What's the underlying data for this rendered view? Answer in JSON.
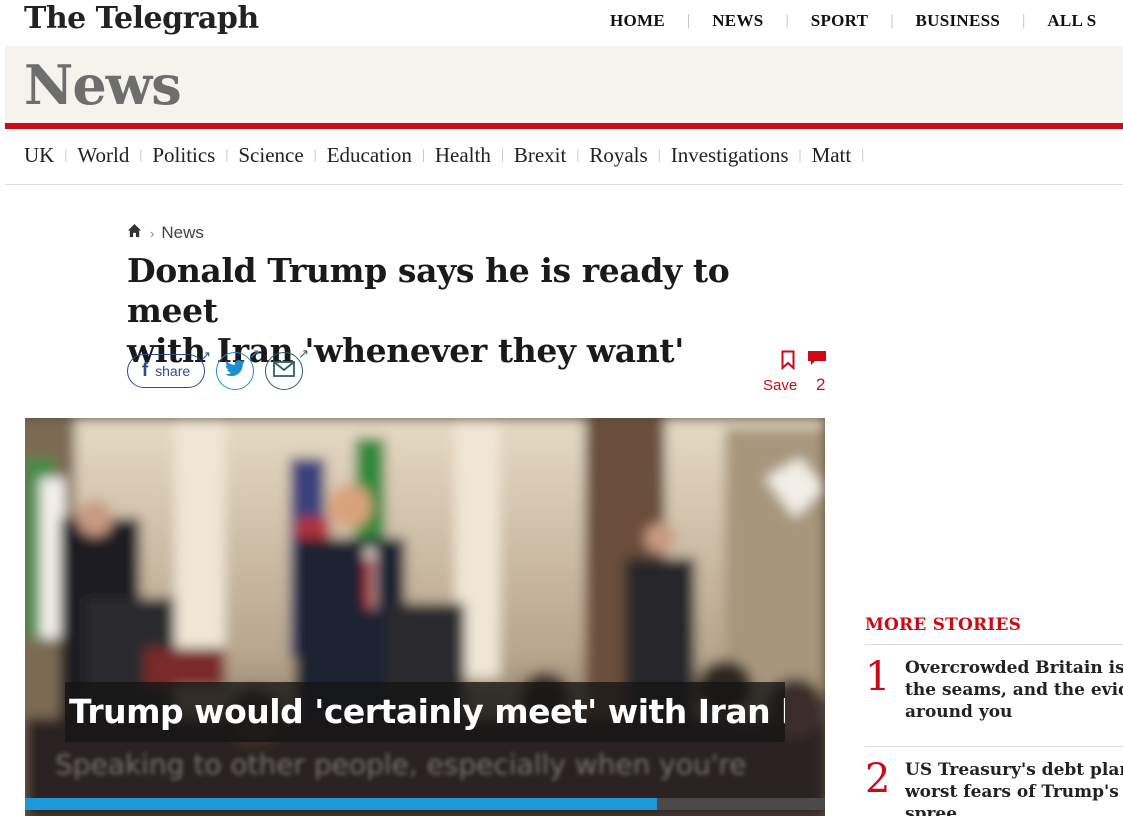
{
  "masthead": {
    "logo": "The Telegraph",
    "nav": [
      {
        "label": "HOME"
      },
      {
        "label": "NEWS"
      },
      {
        "label": "SPORT"
      },
      {
        "label": "BUSINESS"
      },
      {
        "label": "ALL S"
      }
    ]
  },
  "section": {
    "title": "News",
    "subnav": [
      {
        "label": "UK"
      },
      {
        "label": "World"
      },
      {
        "label": "Politics"
      },
      {
        "label": "Science"
      },
      {
        "label": "Education"
      },
      {
        "label": "Health"
      },
      {
        "label": "Brexit"
      },
      {
        "label": "Royals"
      },
      {
        "label": "Investigations"
      },
      {
        "label": "Matt"
      }
    ]
  },
  "article": {
    "breadcrumb": {
      "home_icon": "home-icon",
      "section": "News"
    },
    "headline_line1": "Donald Trump says he is ready to meet",
    "headline_line2": "with Iran 'whenever they want'",
    "share": {
      "facebook_label": "share",
      "twitter_icon": "twitter-icon",
      "email_icon": "email-icon"
    },
    "save_label": "Save",
    "comment_count": "2",
    "colors": {
      "brand_red": "#cc0a17",
      "facebook_blue": "#2b4e8c",
      "twitter_blue": "#1d8fd0"
    }
  },
  "video": {
    "caption": "Trump would 'certainly meet' with Iran l...",
    "subtitle": "Speaking to other people, especially when you're",
    "progress": 0.79
  },
  "more_stories": {
    "title": "MORE STORIES",
    "items": [
      {
        "number": "1",
        "line1": "Overcrowded Britain is b",
        "line2": "the seams, and the evider",
        "line3": "around you"
      },
      {
        "number": "2",
        "line1": "US Treasury's debt plan c",
        "line2": "worst fears of Trump's ru",
        "line3": "spree"
      }
    ]
  }
}
